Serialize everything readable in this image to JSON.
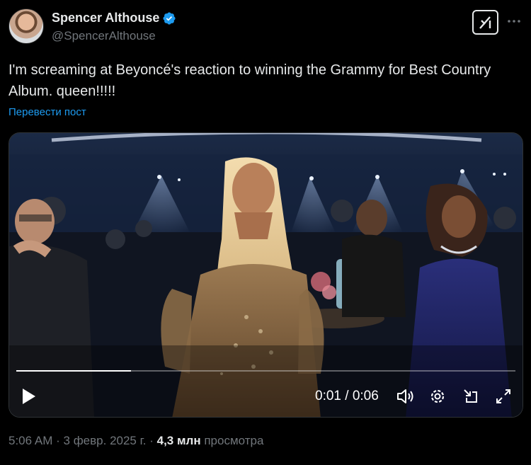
{
  "author": {
    "name": "Spencer Althouse",
    "handle": "@SpencerAlthouse",
    "verified": true
  },
  "tweet": {
    "text": "I'm screaming at Beyoncé's reaction to winning the Grammy for Best Country Album. queen!!!!!",
    "translate_label": "Перевести пост"
  },
  "video": {
    "current_time": "0:01",
    "separator": "/",
    "duration": "0:06",
    "progress": 0.23
  },
  "meta": {
    "time": "5:06 AM",
    "dot": "·",
    "date": "3 февр. 2025 г.",
    "views_count": "4,3 млн",
    "views_label": "просмотра"
  },
  "colors": {
    "accent": "#1d9bf0",
    "text": "#e7e9ea",
    "muted": "#71767b",
    "background": "#000000"
  },
  "icons": [
    "verified-badge-icon",
    "grok-icon",
    "more-icon",
    "play-icon",
    "volume-icon",
    "settings-icon",
    "minimize-icon",
    "fullscreen-icon"
  ]
}
